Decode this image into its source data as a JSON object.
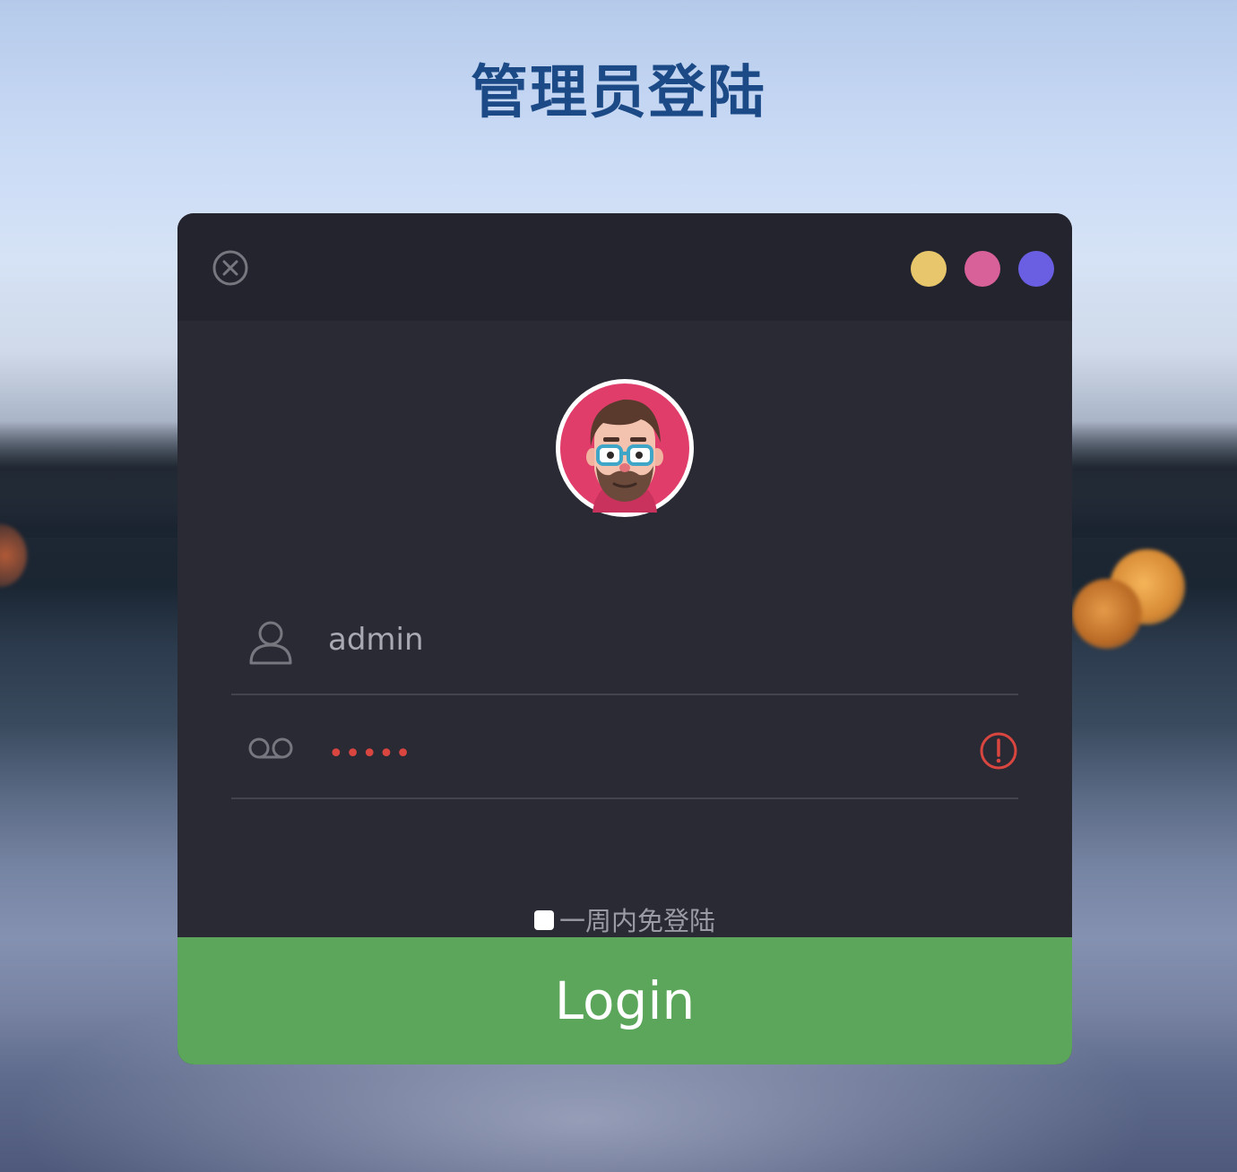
{
  "page": {
    "title": "管理员登陆"
  },
  "window": {
    "close_icon": "close-circle-icon",
    "dots": [
      {
        "name": "yellow",
        "color": "#e8c66b"
      },
      {
        "name": "pink",
        "color": "#d9619a"
      },
      {
        "name": "purple",
        "color": "#6a5fe2"
      }
    ]
  },
  "avatar": {
    "icon": "bearded-man-with-glasses-avatar"
  },
  "form": {
    "username": {
      "icon": "user-icon",
      "value": "admin"
    },
    "password": {
      "icon": "voicemail-key-icon",
      "masked_value": "•••••",
      "status_icon": "alert-circle-icon",
      "status_color": "#d9463f"
    },
    "remember": {
      "label": "一周内免登陆",
      "checked": false
    },
    "submit_label": "Login"
  },
  "colors": {
    "title": "#1c4a86",
    "card": "#2a2a35",
    "card_header": "#24242e",
    "button": "#5ba65b"
  }
}
